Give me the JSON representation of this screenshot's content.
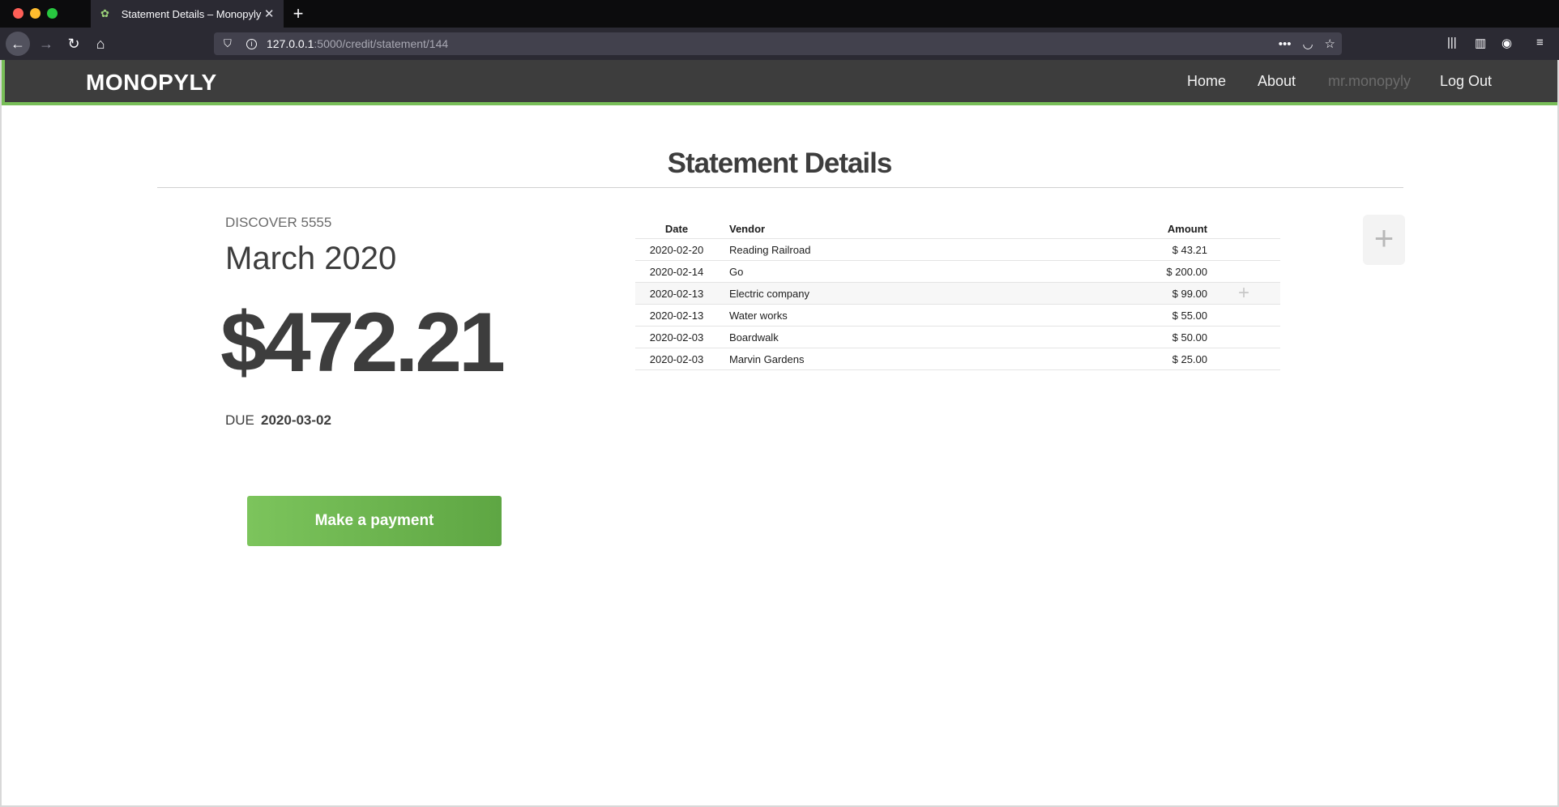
{
  "browser": {
    "tab_title": "Statement Details – Monopyly",
    "tab_close_glyph": "✕",
    "new_tab_glyph": "+",
    "url_host": "127.0.0.1",
    "url_rest": ":5000/credit/statement/144",
    "icons": [
      "back-arrow",
      "forward-arrow",
      "reload",
      "home",
      "shield",
      "info",
      "more-dots",
      "pocket",
      "bookmark-star",
      "library",
      "sidebar",
      "account",
      "hamburger-menu"
    ]
  },
  "header": {
    "logo": "MONOPYLY",
    "nav": {
      "home": "Home",
      "about": "About",
      "user": "mr.monopyly",
      "logout": "Log Out"
    },
    "accent_color": "#78be58"
  },
  "page": {
    "title": "Statement Details"
  },
  "statement": {
    "card": "DISCOVER 5555",
    "month": "March 2020",
    "balance": "$472.21",
    "due_label": "DUE",
    "due_date": "2020-03-02",
    "pay_button": "Make a payment"
  },
  "transactions": {
    "headers": {
      "date": "Date",
      "vendor": "Vendor",
      "amount": "Amount"
    },
    "rows": [
      {
        "date": "2020-02-20",
        "vendor": "Reading Railroad",
        "amount": "$ 43.21"
      },
      {
        "date": "2020-02-14",
        "vendor": "Go",
        "amount": "$ 200.00"
      },
      {
        "date": "2020-02-13",
        "vendor": "Electric company",
        "amount": "$ 99.00"
      },
      {
        "date": "2020-02-13",
        "vendor": "Water works",
        "amount": "$ 55.00"
      },
      {
        "date": "2020-02-03",
        "vendor": "Boardwalk",
        "amount": "$ 50.00"
      },
      {
        "date": "2020-02-03",
        "vendor": "Marvin Gardens",
        "amount": "$ 25.00"
      }
    ],
    "row_plus_glyph": "+",
    "add_glyph": "+"
  }
}
